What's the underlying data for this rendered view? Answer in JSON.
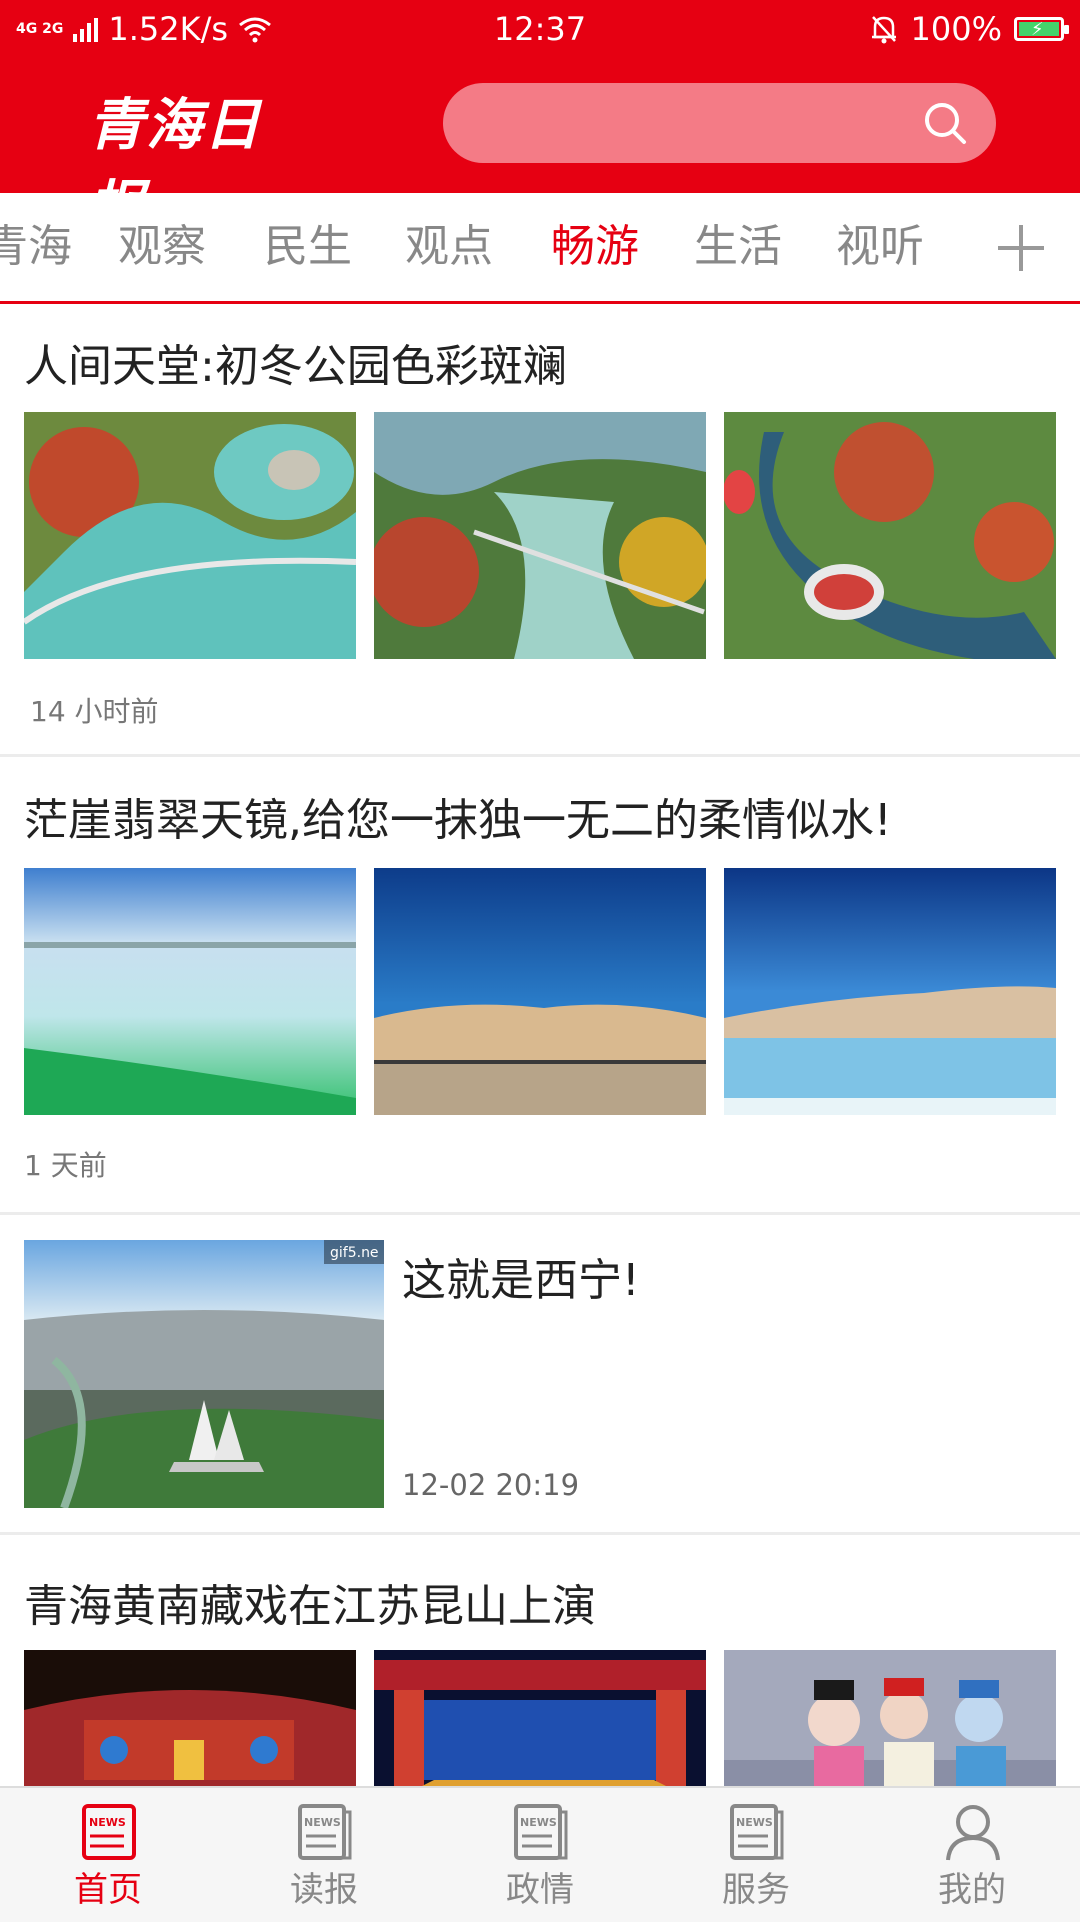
{
  "status": {
    "network": "4G 2G",
    "speed": "1.52K/s",
    "time": "12:37",
    "battery": "100%"
  },
  "header": {
    "logo_text": "青海日报",
    "search_placeholder": ""
  },
  "tabs": [
    {
      "label": "青海",
      "active": false
    },
    {
      "label": "观察",
      "active": false
    },
    {
      "label": "民生",
      "active": false
    },
    {
      "label": "观点",
      "active": false
    },
    {
      "label": "畅游",
      "active": true
    },
    {
      "label": "生活",
      "active": false
    },
    {
      "label": "视听",
      "active": false
    }
  ],
  "articles": [
    {
      "title": "人间天堂:初冬公园色彩斑斓",
      "time": "14 小时前"
    },
    {
      "title": "茫崖翡翠天镜,给您一抹独一无二的柔情似水!",
      "time": "1 天前"
    },
    {
      "title": "这就是西宁!",
      "time": "12-02 20:19",
      "watermark": "gif5.ne"
    },
    {
      "title": "青海黄南藏戏在江苏昆山上演"
    }
  ],
  "nav": [
    {
      "label": "首页",
      "badge": "NEWS",
      "active": true
    },
    {
      "label": "读报",
      "badge": "NEWS",
      "active": false
    },
    {
      "label": "政情",
      "badge": "NEWS",
      "active": false
    },
    {
      "label": "服务",
      "badge": "NEWS",
      "active": false
    },
    {
      "label": "我的",
      "active": false
    }
  ],
  "colors": {
    "brand": "#e60012",
    "search_bg": "#f47b86",
    "inactive_text": "#888888"
  }
}
